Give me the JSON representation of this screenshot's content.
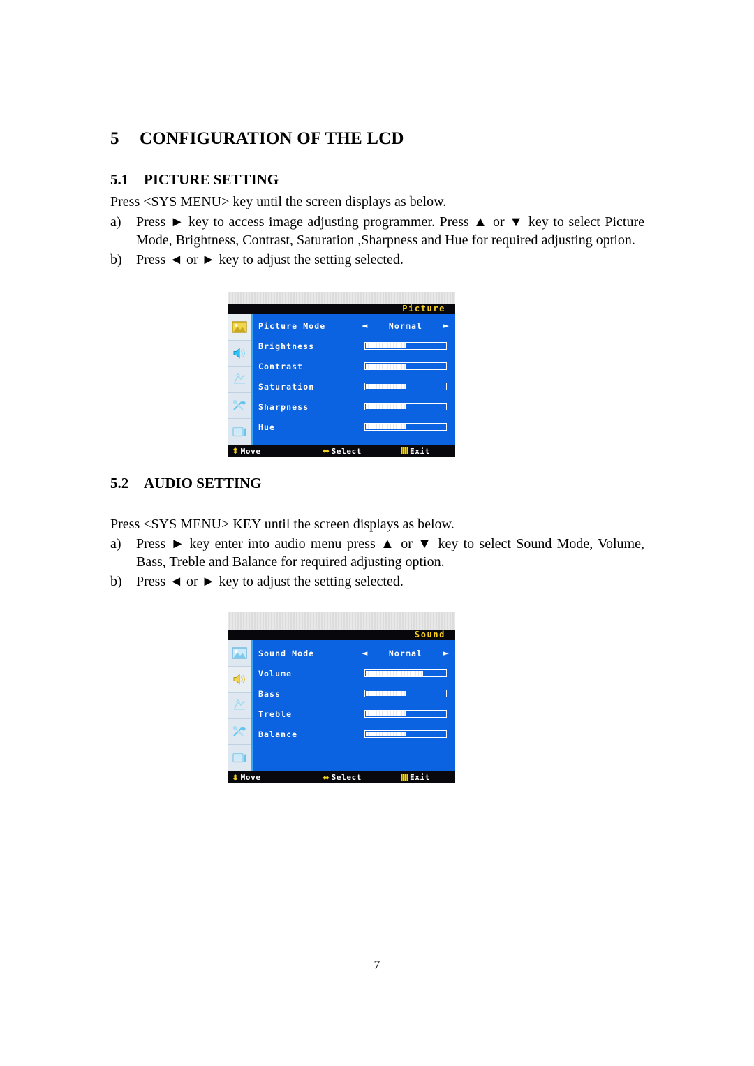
{
  "document": {
    "page_number": "7"
  },
  "chapter": {
    "number": "5",
    "title": "CONFIGURATION OF THE LCD"
  },
  "sections": [
    {
      "number": "5.1",
      "title": "PICTURE SETTING",
      "intro": "Press <SYS MENU> key until the screen displays as below.",
      "steps": [
        {
          "marker": "a)",
          "text": "Press ► key to access image adjusting programmer. Press ▲ or ▼ key to select Picture Mode, Brightness, Contrast, Saturation ,Sharpness and Hue for required adjusting option."
        },
        {
          "marker": "b)",
          "text": "Press ◄ or ► key to adjust the setting selected."
        }
      ]
    },
    {
      "number": "5.2",
      "title": "AUDIO SETTING",
      "intro": "Press <SYS MENU> KEY until the screen displays as below.",
      "steps": [
        {
          "marker": "a)",
          "text": "Press ► key enter into audio menu press ▲ or ▼ key to select Sound Mode, Volume, Bass, Treble and Balance for required adjusting option."
        },
        {
          "marker": "b)",
          "text": "Press ◄ or ► key to adjust the setting selected."
        }
      ]
    }
  ],
  "osd_picture": {
    "title": "Picture",
    "title_color": "#f6cf22",
    "background_color": "#0b63e2",
    "active_rail_index": 0,
    "rail_icons": [
      "picture-icon",
      "sound-icon",
      "function-icon",
      "tools-icon",
      "display-icon"
    ],
    "rows": [
      {
        "label": "Picture Mode",
        "type": "option",
        "value": "Normal",
        "left_arrow": "◄",
        "right_arrow": "►"
      },
      {
        "label": "Brightness",
        "type": "slider",
        "percent": 50
      },
      {
        "label": "Contrast",
        "type": "slider",
        "percent": 50
      },
      {
        "label": "Saturation",
        "type": "slider",
        "percent": 50
      },
      {
        "label": "Sharpness",
        "type": "slider",
        "percent": 50
      },
      {
        "label": "Hue",
        "type": "slider",
        "percent": 50
      }
    ],
    "footer": {
      "move_label": "Move",
      "move_glyph": "⬍",
      "select_label": "Select",
      "select_glyph": "⬌",
      "exit_label": "Exit",
      "exit_glyph": "menu-key-icon"
    }
  },
  "osd_sound": {
    "title": "Sound",
    "title_color": "#f6cf22",
    "background_color": "#0b63e2",
    "active_rail_index": 1,
    "rail_icons": [
      "picture-icon",
      "sound-icon",
      "function-icon",
      "tools-icon",
      "display-icon"
    ],
    "rows": [
      {
        "label": "Sound Mode",
        "type": "option",
        "value": "Normal",
        "left_arrow": "◄",
        "right_arrow": "►"
      },
      {
        "label": "Volume",
        "type": "slider",
        "percent": 72
      },
      {
        "label": "Bass",
        "type": "slider",
        "percent": 50
      },
      {
        "label": "Treble",
        "type": "slider",
        "percent": 50
      },
      {
        "label": "Balance",
        "type": "slider",
        "percent": 50
      }
    ],
    "footer": {
      "move_label": "Move",
      "move_glyph": "⬍",
      "select_label": "Select",
      "select_glyph": "⬌",
      "exit_label": "Exit",
      "exit_glyph": "menu-key-icon"
    }
  }
}
